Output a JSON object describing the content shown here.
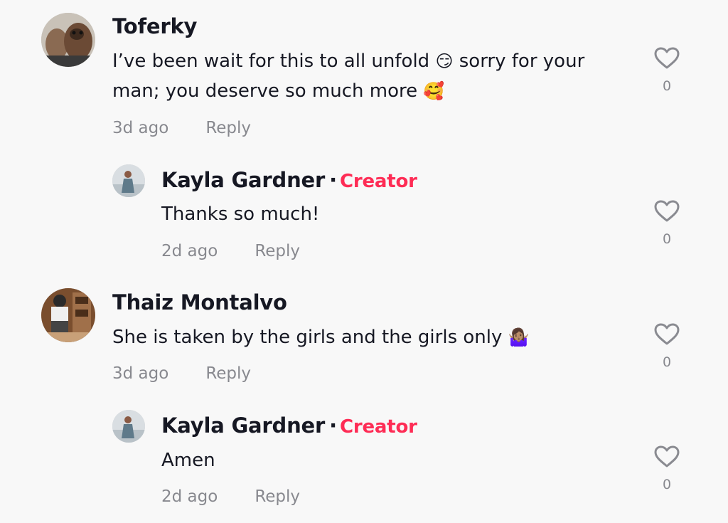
{
  "comments": [
    {
      "author": "Toferky",
      "text_line1_a": "I’ve been wait for this to all unfold ",
      "emoji1": "😏",
      "text_line1_b": " sorry for your",
      "text_line2": "man; you deserve so much more ",
      "emoji2": "🥰",
      "time": "3d ago",
      "reply": "Reply",
      "likes": "0"
    },
    {
      "author": "Kayla Gardner",
      "dot": "·",
      "badge": "Creator",
      "text": "Thanks so much!",
      "time": "2d ago",
      "reply": "Reply",
      "likes": "0"
    },
    {
      "author": "Thaiz Montalvo",
      "text": "She is taken by the girls and the girls only ",
      "emoji": "🤷🏽‍♀️",
      "time": "3d ago",
      "reply": "Reply",
      "likes": "0"
    },
    {
      "author": "Kayla Gardner",
      "dot": "·",
      "badge": "Creator",
      "text": "Amen",
      "time": "2d ago",
      "reply": "Reply",
      "likes": "0"
    }
  ],
  "colors": {
    "creator_badge": "#fe2c55",
    "text_primary": "#161823",
    "text_secondary": "#8a8b91"
  },
  "icons": {
    "like": "heart-outline-icon"
  }
}
